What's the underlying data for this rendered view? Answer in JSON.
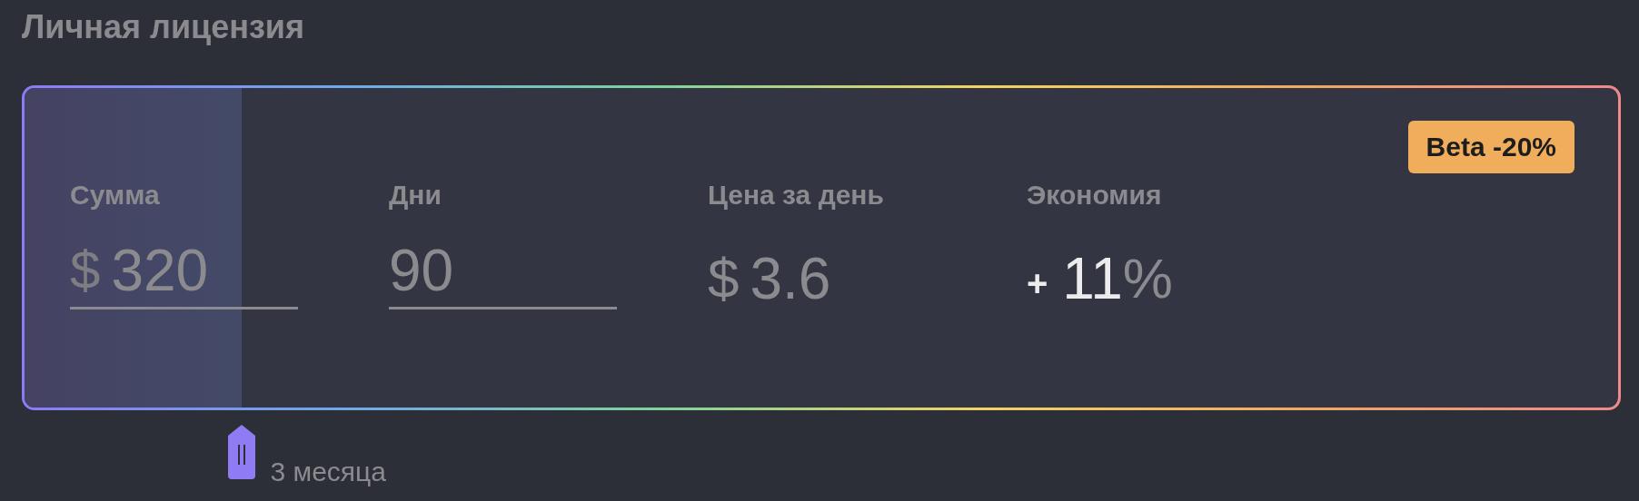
{
  "title": "Личная лицензия",
  "badge": "Beta -20%",
  "fields": [
    {
      "kind": "input",
      "label": "Сумма",
      "prefix": "$",
      "value": "320"
    },
    {
      "kind": "input",
      "label": "Дни",
      "value": "90"
    },
    {
      "kind": "stat",
      "label": "Цена за день",
      "prefix": "$",
      "value": "3.6"
    },
    {
      "kind": "stat",
      "label": "Экономия",
      "sign": "+",
      "value": "11",
      "unit": "%"
    }
  ],
  "slider": {
    "level": 0.136,
    "label": "3 месяца"
  }
}
